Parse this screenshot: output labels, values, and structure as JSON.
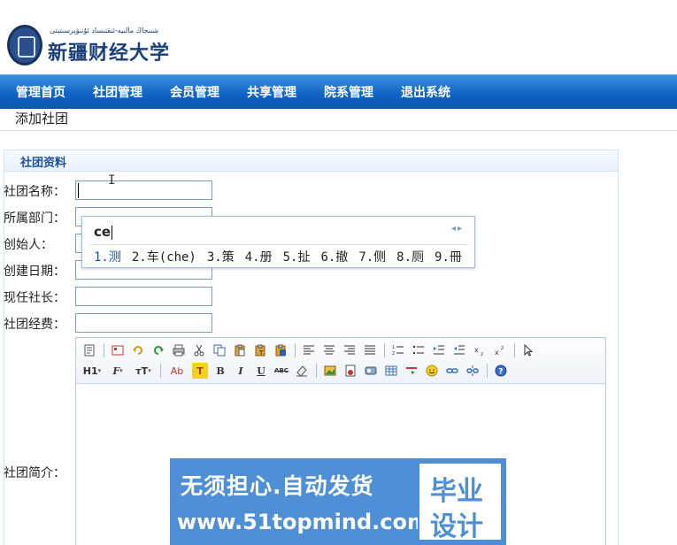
{
  "header": {
    "university_name": "新疆财经大学",
    "university_name_uyghur": "شىنجاڭ مالىيە-ئىقتىساد ئۇنىۋېرسىتېتى"
  },
  "nav": {
    "items": [
      "管理首页",
      "社团管理",
      "会员管理",
      "共享管理",
      "院系管理",
      "退出系统"
    ]
  },
  "page": {
    "subtitle": "添加社团"
  },
  "form": {
    "section_title": "社团资料",
    "fields": [
      {
        "label": "社团名称：",
        "value": ""
      },
      {
        "label": "所属部门：",
        "value": ""
      },
      {
        "label": "创始人：",
        "value": ""
      },
      {
        "label": "创建日期：",
        "value": ""
      },
      {
        "label": "现任社长：",
        "value": ""
      },
      {
        "label": "社团经费：",
        "value": ""
      }
    ],
    "intro_label": "社团简介："
  },
  "editor": {
    "toolbar_row1": [
      "source-icon",
      "preview-icon",
      "undo-icon",
      "redo-icon",
      "print-icon",
      "cut-icon",
      "copy-icon",
      "paste-icon",
      "paste-text-icon",
      "paste-word-icon",
      "align-left-icon",
      "align-center-icon",
      "align-right-icon",
      "justify-icon",
      "ordered-list-icon",
      "unordered-list-icon",
      "indent-icon",
      "outdent-icon",
      "subscript-icon",
      "superscript-icon",
      "select-all-icon"
    ],
    "toolbar_row2_labels": {
      "heading": "H1",
      "font": "F",
      "font_size": "тT",
      "text_color": "Ab",
      "highlight": "T",
      "bold": "B",
      "italic": "I",
      "underline": "U",
      "strikethrough": "ABC"
    }
  },
  "ime": {
    "input": "ce",
    "candidates": [
      "1.测",
      "2.车(che)",
      "3.策",
      "4.册",
      "5.扯",
      "6.撤",
      "7.侧",
      "8.厕",
      "9.冊"
    ],
    "arrows": "◂▸"
  },
  "watermark": {
    "line1": "无须担心.自动发货",
    "line2": "www.51topmind.com",
    "box_line1": "毕业",
    "box_line2": "设计"
  },
  "colors": {
    "nav_blue": "#0e62c3",
    "section_title": "#1d4f9c",
    "ad_blue": "#4f8fd5"
  }
}
